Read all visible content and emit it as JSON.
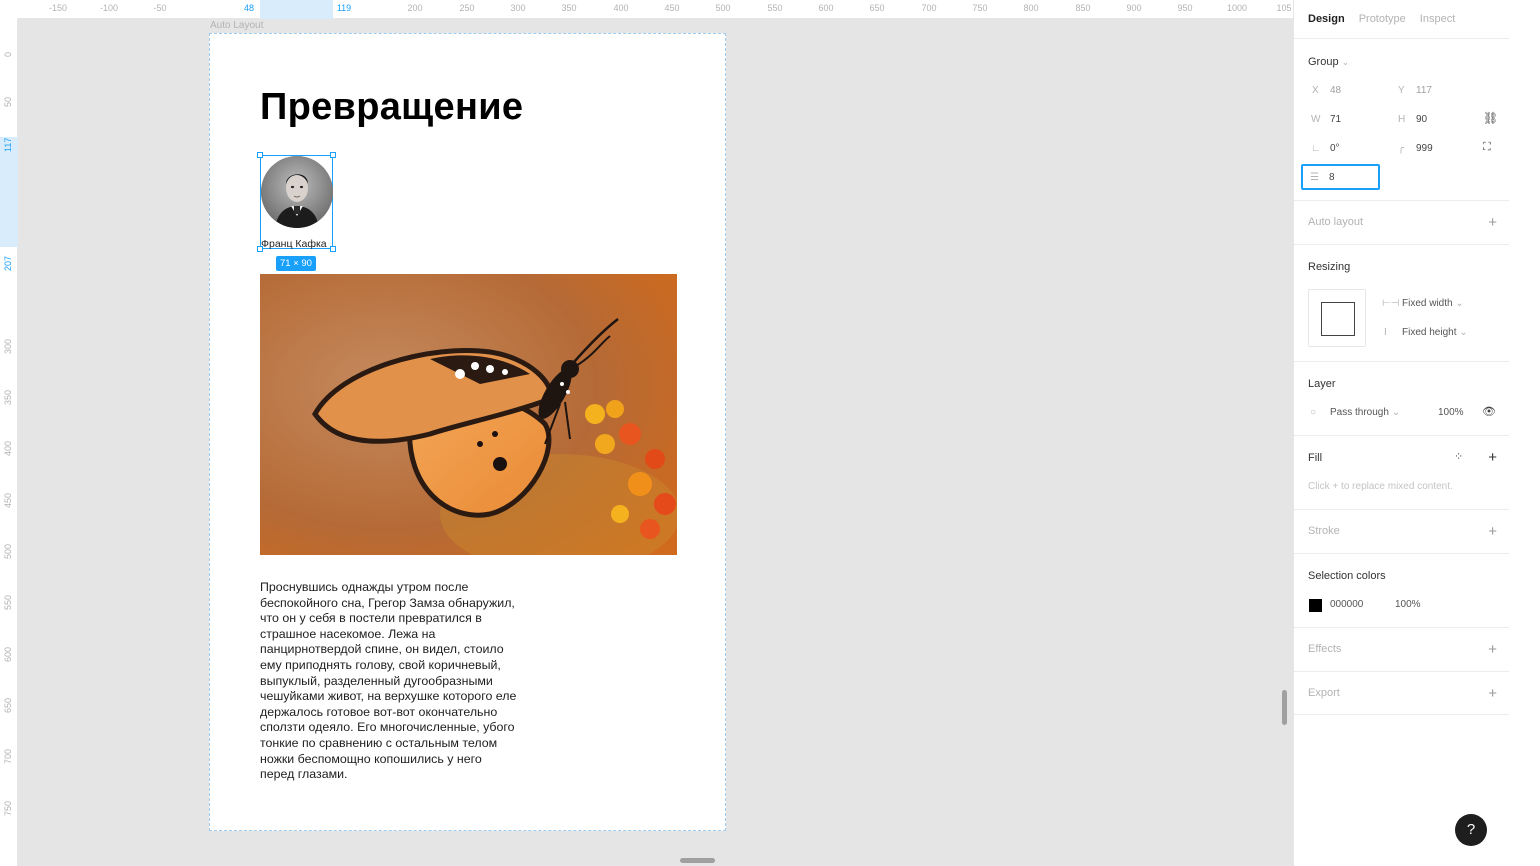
{
  "ruler": {
    "top_ticks": [
      "-150",
      "-100",
      "-50",
      "48",
      "119",
      "200",
      "250",
      "300",
      "350",
      "400",
      "450",
      "500",
      "550",
      "600",
      "650",
      "700",
      "750",
      "800",
      "850",
      "900",
      "950",
      "1000",
      "105"
    ],
    "left_ticks": [
      "0",
      "50",
      "117",
      "207",
      "300",
      "350",
      "400",
      "450",
      "500",
      "550",
      "600",
      "650",
      "700",
      "750"
    ]
  },
  "canvas": {
    "frame_label": "Auto Layout",
    "title": "Превращение",
    "author_name": "Франц Кафка",
    "size_badge": "71 × 90",
    "body_text": "Проснувшись однажды утром после\nбеспокойного сна, Грегор Замза обнаружил,\nчто он у себя в постели превратился в\nстрашное насекомое. Лежа на\nпанцирнотвердой спине, он видел, стоило\nему приподнять голову, свой коричневый,\nвыпуклый, разделенный дугообразными\nчешуйками живот, на верхушке которого еле\nдержалось готовое вот-вот окончательно\nсползти одеяло. Его многочисленные, убого\nтонкие по сравнению с остальным телом\nножки беспомощно копошились у него\nперед глазами."
  },
  "panel": {
    "tabs": [
      "Design",
      "Prototype",
      "Inspect"
    ],
    "group": {
      "title": "Group",
      "x_label": "X",
      "x_value": "48",
      "y_label": "Y",
      "y_value": "117",
      "w_label": "W",
      "w_value": "71",
      "h_label": "H",
      "h_value": "90",
      "rotation_value": "0°",
      "radius_value": "999",
      "spacing_value": "8"
    },
    "auto_layout": "Auto layout",
    "resizing": {
      "title": "Resizing",
      "width_mode": "Fixed width",
      "height_mode": "Fixed height"
    },
    "layer": {
      "title": "Layer",
      "blend": "Pass through",
      "opacity": "100%"
    },
    "fill": {
      "title": "Fill",
      "hint": "Click + to replace mixed content."
    },
    "stroke": "Stroke",
    "selection_colors": {
      "title": "Selection colors",
      "hex": "000000",
      "opacity": "100%"
    },
    "effects": "Effects",
    "export": "Export",
    "help": "?"
  },
  "colors": {
    "accent": "#18a0fb",
    "canvas_bg": "#e5e5e5",
    "panel_bg": "#ffffff",
    "swatch": "#000000"
  }
}
